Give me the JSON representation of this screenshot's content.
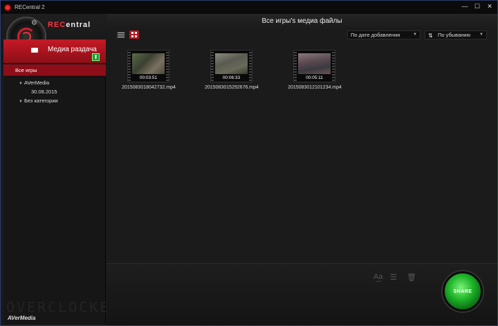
{
  "window": {
    "title": "RECentral 2",
    "controls": {
      "minimize": "—",
      "maximize": "☐",
      "close": "✕"
    }
  },
  "brand": {
    "rec": "REC",
    "rest": "entral"
  },
  "sidebar": {
    "active_section": "Медиа раздача",
    "categories": {
      "all": "Все игры",
      "tree": [
        {
          "label": "AVerMedia",
          "child": "30.08.2015"
        },
        {
          "label": "Без категории"
        }
      ]
    },
    "footer_logo": "AVerMedia",
    "watermark": "OVERCLOCKERS.ru"
  },
  "main": {
    "header": "Все игры's медиа файлы",
    "sort_by": "По дате добавления",
    "sort_order": "По убыванию",
    "files": [
      {
        "name": "2015083018042732.mp4",
        "duration": "00:03:51"
      },
      {
        "name": "2015083015292676.mp4",
        "duration": "00:06:33"
      },
      {
        "name": "2015083012101234.mp4",
        "duration": "00:05:11"
      }
    ],
    "share_label": "SHARE"
  },
  "colors": {
    "accent_red": "#c51925",
    "share_green": "#1fb62a"
  }
}
